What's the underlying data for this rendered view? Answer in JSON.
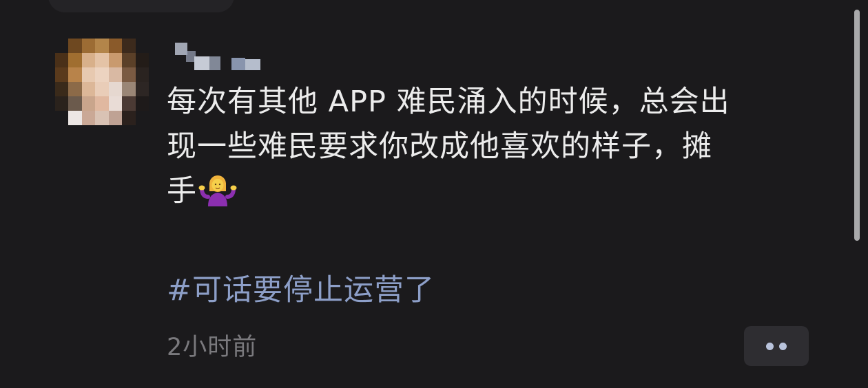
{
  "post": {
    "text_line1": "每次有其他 APP 难民涌入的时候，总会出",
    "text_line2": "现一些难民要求你改成他喜欢的样子，摊",
    "text_line3": "手",
    "emoji": "person-shrugging-emoji",
    "hashtag": "#可话要停止运营了",
    "timestamp": "2小时前"
  },
  "icons": {
    "more": "more-dots-icon",
    "avatar": "pixelated-avatar"
  },
  "colors": {
    "background": "#1b1a1c",
    "text": "#ececec",
    "hashtag": "#8d9fc8",
    "timestamp": "#7a797d",
    "button_bg": "#2e2d31"
  }
}
